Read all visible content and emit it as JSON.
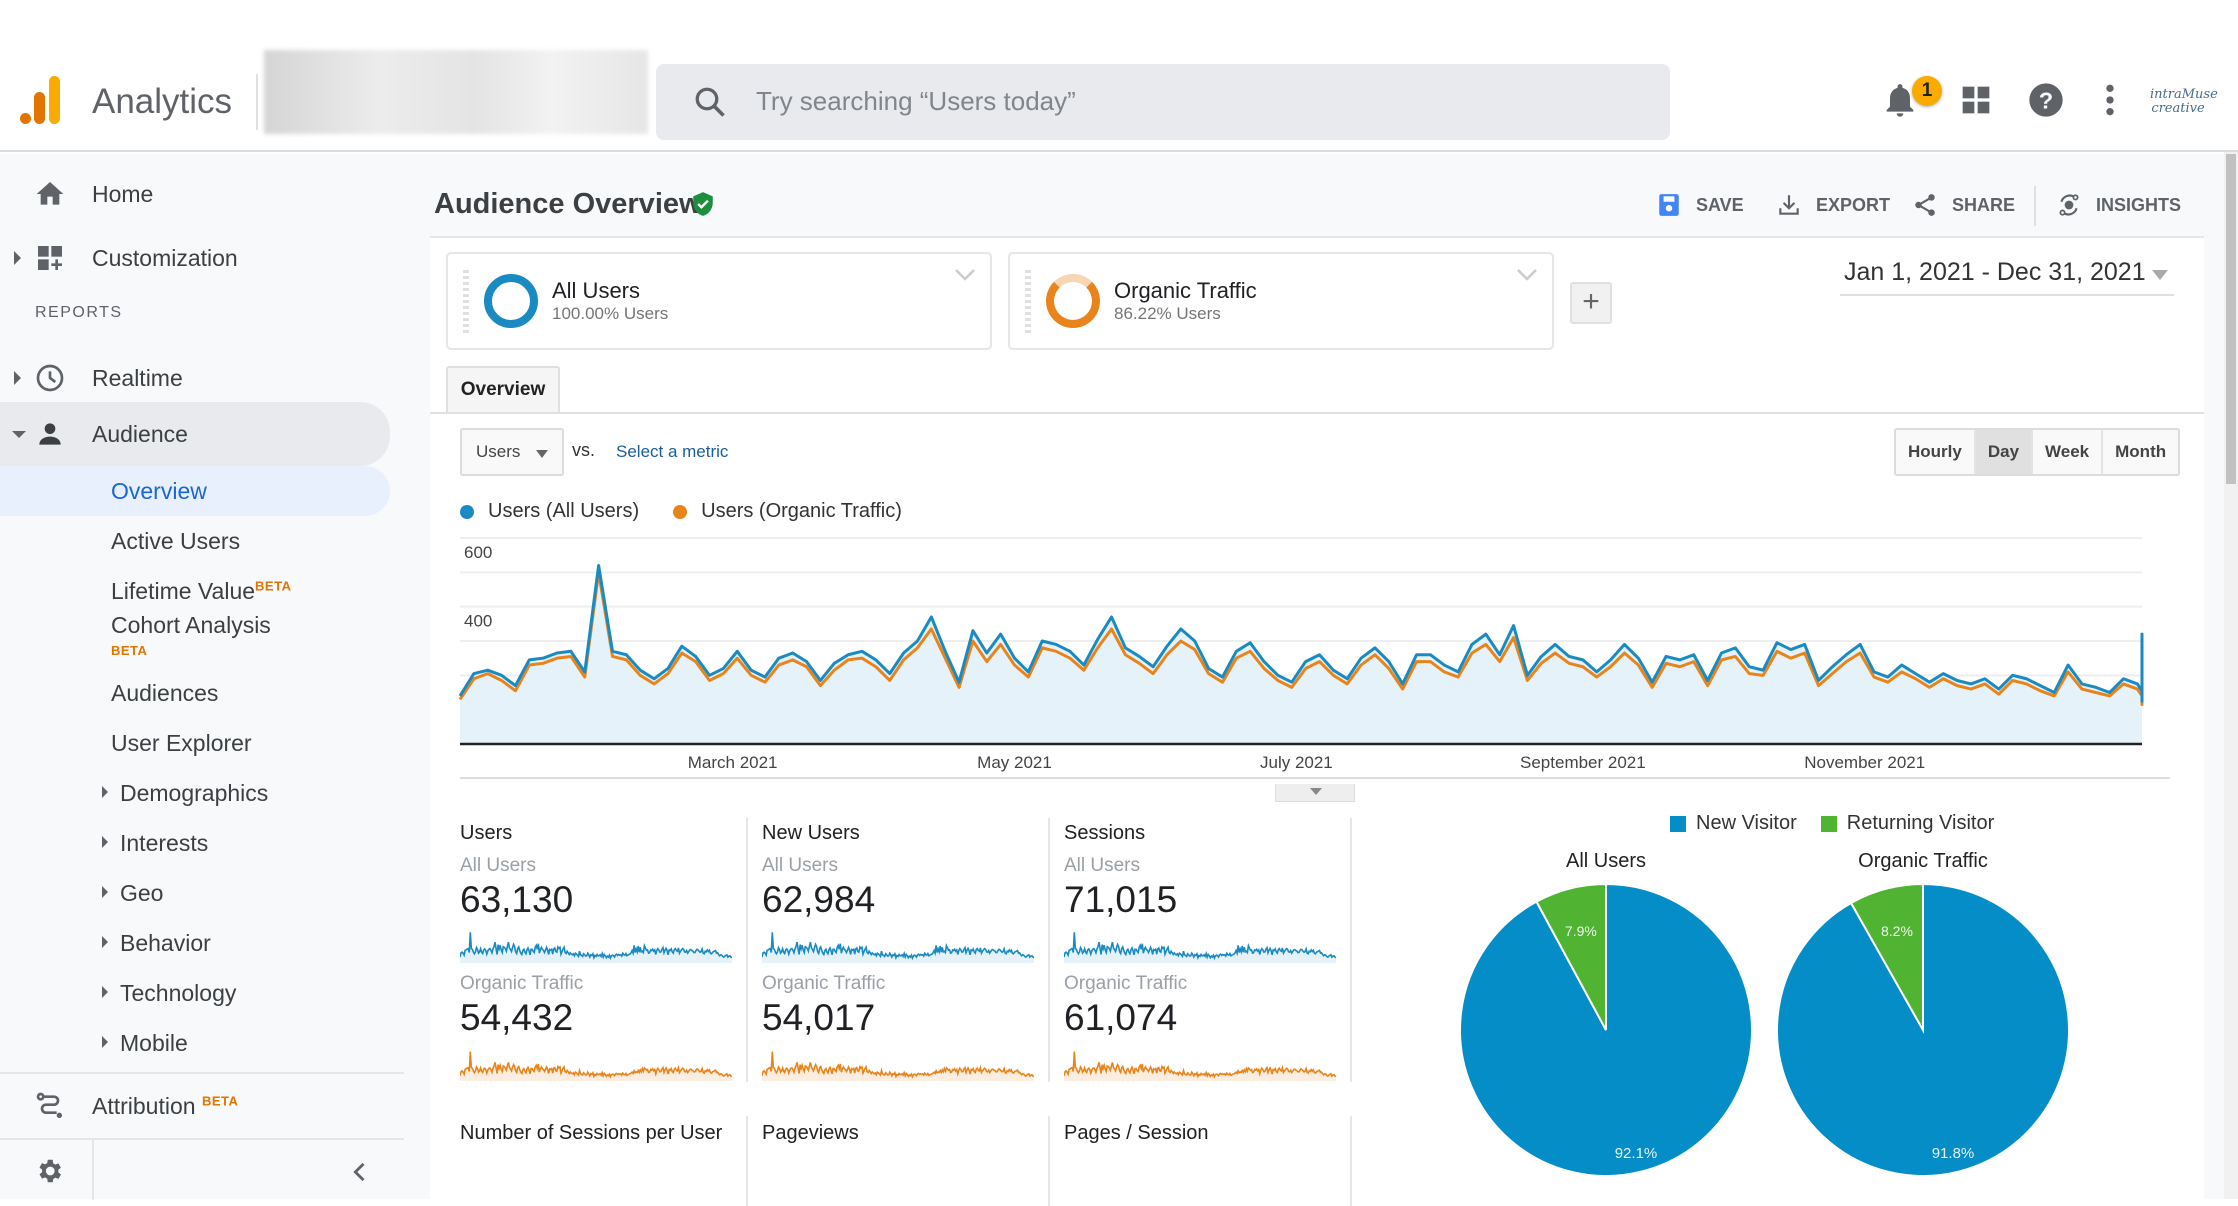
{
  "header": {
    "app_title": "Analytics",
    "search_placeholder": "Try searching “Users today”",
    "notification_count": "1",
    "avatar_text": "intraMuse creative"
  },
  "sidebar": {
    "top_items": [
      {
        "label": "Home",
        "icon": "home-icon"
      },
      {
        "label": "Customization",
        "icon": "dashboard-customize-icon"
      }
    ],
    "reports_header": "REPORTS",
    "realtime": {
      "label": "Realtime",
      "icon": "clock-icon"
    },
    "audience": {
      "label": "Audience",
      "icon": "person-icon"
    },
    "audience_children": [
      {
        "label": "Overview",
        "selected": true
      },
      {
        "label": "Active Users"
      },
      {
        "label": "Lifetime Value",
        "badge": "BETA"
      },
      {
        "label": "Cohort Analysis",
        "badge": "BETA"
      },
      {
        "label": "Audiences"
      },
      {
        "label": "User Explorer"
      },
      {
        "label": "Demographics",
        "expandable": true
      },
      {
        "label": "Interests",
        "expandable": true
      },
      {
        "label": "Geo",
        "expandable": true
      },
      {
        "label": "Behavior",
        "expandable": true
      },
      {
        "label": "Technology",
        "expandable": true
      },
      {
        "label": "Mobile",
        "expandable": true
      }
    ],
    "attribution": {
      "label": "Attribution",
      "badge": "BETA",
      "icon": "attribution-icon"
    }
  },
  "page": {
    "title": "Audience Overview",
    "actions": {
      "save": "SAVE",
      "export": "EXPORT",
      "share": "SHARE",
      "insights": "INSIGHTS"
    },
    "segments": [
      {
        "name": "All Users",
        "sub": "100.00% Users",
        "color": "#1a8ac2",
        "share": 1.0
      },
      {
        "name": "Organic Traffic",
        "sub": "86.22% Users",
        "color": "#e8841a",
        "share": 0.8622
      }
    ],
    "date_range": "Jan 1, 2021 - Dec 31, 2021",
    "tab": "Overview",
    "metric_select": "Users",
    "vs_label": "vs.",
    "select_metric_link": "Select a metric",
    "granularity": [
      "Hourly",
      "Day",
      "Week",
      "Month"
    ],
    "granularity_selected": "Day"
  },
  "chart_data": [
    {
      "type": "line",
      "title": "",
      "xlabel": "",
      "ylabel": "",
      "ylim": [
        0,
        600
      ],
      "yticks": [
        200,
        400,
        600
      ],
      "x_tick_labels": [
        "March 2021",
        "May 2021",
        "July 2021",
        "September 2021",
        "November 2021"
      ],
      "x_tick_positions_day": [
        59,
        120,
        181,
        243,
        304
      ],
      "x_range_days": [
        0,
        364
      ],
      "legend": "top-left",
      "grid": true,
      "series": [
        {
          "name": "Users (All Users)",
          "color": "#1a8ac2",
          "sample_every_days": 3,
          "values": [
            140,
            205,
            215,
            200,
            170,
            245,
            250,
            265,
            270,
            210,
            520,
            270,
            260,
            215,
            190,
            220,
            285,
            255,
            200,
            220,
            270,
            215,
            195,
            250,
            265,
            240,
            185,
            235,
            260,
            270,
            245,
            205,
            265,
            300,
            370,
            270,
            180,
            330,
            265,
            320,
            250,
            210,
            300,
            290,
            270,
            230,
            305,
            370,
            280,
            255,
            225,
            285,
            335,
            300,
            220,
            195,
            270,
            295,
            240,
            200,
            180,
            240,
            260,
            215,
            190,
            250,
            280,
            240,
            175,
            260,
            260,
            230,
            210,
            290,
            320,
            260,
            345,
            200,
            255,
            290,
            255,
            245,
            210,
            245,
            290,
            250,
            180,
            255,
            245,
            260,
            185,
            265,
            280,
            225,
            215,
            295,
            275,
            290,
            185,
            225,
            260,
            290,
            210,
            195,
            230,
            205,
            180,
            205,
            185,
            175,
            190,
            160,
            200,
            190,
            170,
            150,
            230,
            175,
            165,
            150,
            190,
            175,
            155,
            160,
            200,
            175,
            140,
            175,
            165,
            190,
            130,
            165,
            150,
            180,
            160,
            160,
            175,
            150,
            195,
            140,
            180,
            160,
            130,
            155,
            140,
            170,
            125,
            160,
            170,
            160,
            140,
            175,
            185,
            165,
            180,
            170,
            175,
            155,
            200,
            175,
            170,
            195,
            160,
            170,
            180,
            185,
            205,
            240,
            200,
            320,
            210,
            265,
            220,
            310,
            215,
            290,
            220,
            230,
            210,
            315,
            280,
            245,
            250,
            200,
            205,
            250,
            240,
            260,
            230,
            250,
            180,
            240,
            270,
            250,
            215,
            220,
            260,
            285,
            205,
            245,
            275,
            240,
            175,
            250,
            240,
            265,
            220,
            200,
            255,
            270,
            240,
            230,
            280,
            200,
            230,
            250,
            270,
            260,
            220,
            215,
            240,
            200,
            225,
            250,
            255,
            240,
            235,
            210,
            210,
            240,
            260,
            250,
            230,
            215,
            225,
            265,
            200,
            190,
            230,
            220,
            250,
            225,
            245,
            200,
            190,
            210,
            225,
            230,
            240,
            200,
            205,
            180,
            160,
            175,
            170,
            150,
            140,
            155,
            165,
            175,
            140,
            155,
            160,
            140,
            130
          ]
        },
        {
          "name": "Users (Organic Traffic)",
          "color": "#e8841a",
          "sample_every_days": 3,
          "values": [
            130,
            190,
            205,
            185,
            155,
            230,
            235,
            250,
            255,
            195,
            500,
            255,
            245,
            200,
            175,
            205,
            265,
            240,
            185,
            205,
            250,
            200,
            180,
            230,
            245,
            225,
            170,
            215,
            245,
            250,
            225,
            185,
            245,
            280,
            335,
            250,
            165,
            300,
            240,
            290,
            230,
            195,
            280,
            270,
            250,
            215,
            280,
            335,
            260,
            235,
            205,
            260,
            300,
            275,
            205,
            180,
            250,
            270,
            220,
            185,
            165,
            220,
            240,
            200,
            175,
            230,
            260,
            220,
            160,
            240,
            240,
            210,
            195,
            265,
            290,
            240,
            310,
            185,
            235,
            265,
            235,
            225,
            195,
            225,
            265,
            230,
            165,
            235,
            225,
            240,
            170,
            245,
            255,
            205,
            200,
            270,
            250,
            265,
            170,
            205,
            240,
            265,
            195,
            180,
            210,
            190,
            165,
            190,
            170,
            160,
            175,
            145,
            185,
            175,
            155,
            140,
            210,
            160,
            150,
            140,
            175,
            160,
            140,
            145,
            185,
            160,
            128,
            160,
            150,
            175,
            120,
            150,
            138,
            165,
            148,
            148,
            160,
            138,
            178,
            128,
            165,
            148,
            120,
            142,
            130,
            155,
            115,
            148,
            155,
            148,
            130,
            160,
            165,
            150,
            160,
            150,
            158,
            140,
            170,
            150,
            145,
            165,
            135,
            145,
            155,
            160,
            170,
            185,
            165,
            205,
            175,
            190,
            180,
            210,
            180,
            220,
            190,
            240,
            200,
            250,
            235,
            215,
            225,
            180,
            185,
            225,
            215,
            235,
            205,
            225,
            160,
            215,
            245,
            225,
            190,
            195,
            235,
            255,
            180,
            220,
            250,
            215,
            155,
            225,
            215,
            240,
            195,
            180,
            230,
            245,
            215,
            205,
            255,
            180,
            205,
            225,
            245,
            235,
            195,
            190,
            215,
            180,
            200,
            225,
            230,
            215,
            210,
            190,
            190,
            215,
            235,
            225,
            205,
            190,
            200,
            240,
            180,
            170,
            205,
            195,
            225,
            200,
            220,
            180,
            170,
            190,
            200,
            205,
            215,
            180,
            185,
            160,
            145,
            160,
            155,
            135,
            125,
            140,
            150,
            160,
            125,
            140,
            145,
            125,
            118
          ]
        }
      ]
    },
    {
      "type": "pie",
      "title": "All Users",
      "legend": "top",
      "labels": [
        "New Visitor",
        "Returning Visitor"
      ],
      "colors": [
        "#058dc7",
        "#50b432"
      ],
      "values": [
        92.1,
        7.9
      ]
    },
    {
      "type": "pie",
      "title": "Organic Traffic",
      "legend": "top",
      "labels": [
        "New Visitor",
        "Returning Visitor"
      ],
      "colors": [
        "#058dc7",
        "#50b432"
      ],
      "values": [
        91.8,
        8.2
      ]
    }
  ],
  "metrics": [
    {
      "title": "Users",
      "seg1": "All Users",
      "val1": "63,130",
      "seg2": "Organic Traffic",
      "val2": "54,432"
    },
    {
      "title": "New Users",
      "seg1": "All Users",
      "val1": "62,984",
      "seg2": "Organic Traffic",
      "val2": "54,017"
    },
    {
      "title": "Sessions",
      "seg1": "All Users",
      "val1": "71,015",
      "seg2": "Organic Traffic",
      "val2": "61,074"
    }
  ],
  "metrics_row2": [
    {
      "title": "Number of Sessions per User"
    },
    {
      "title": "Pageviews"
    },
    {
      "title": "Pages / Session"
    }
  ],
  "pie_legend": [
    {
      "label": "New Visitor",
      "color": "#058dc7"
    },
    {
      "label": "Returning Visitor",
      "color": "#50b432"
    }
  ]
}
